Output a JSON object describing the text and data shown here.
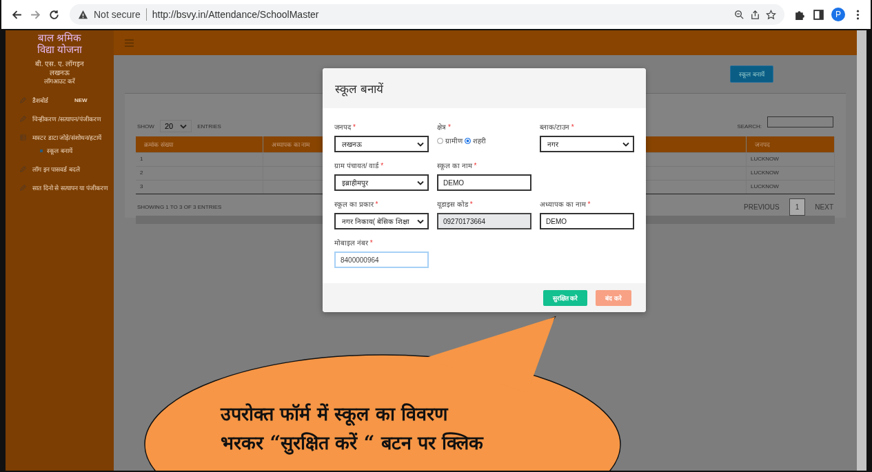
{
  "browser": {
    "security": "Not secure",
    "url": "http://bsvy.in/Attendance/SchoolMaster",
    "avatar": "P"
  },
  "sidebar": {
    "title_lines": [
      "बाल श्रमिक",
      "विद्या योजना"
    ],
    "user_lines": [
      "बी. एस. ए. लॉगइन",
      "लखनऊ"
    ],
    "logout": "लॉगआउट करें",
    "items": [
      {
        "label": "डैशबोर्ड",
        "badge": "NEW"
      },
      {
        "label": "चिन्हीकरण /सत्यापन/पंजीकरण"
      },
      {
        "label": "मास्टर डाटा जोड़े/संशोधन/हटायें",
        "children": [
          {
            "label": "स्कूल बनायें"
          }
        ]
      },
      {
        "label": "लॉग इन पासवर्ड बदले"
      },
      {
        "label": "सात दिनो से सत्यापन या पंजीकरण"
      }
    ]
  },
  "page": {
    "create_button": "स्कूल बनायें",
    "show_label": "SHOW",
    "page_size": "20",
    "entries_label": "ENTRIES",
    "search_label": "SEARCH:",
    "table": {
      "columns": [
        "क्रमांक संख्या",
        "अध्यापक का नाम",
        "जनपद"
      ],
      "rows": [
        [
          "1",
          "",
          "LUCKNOW"
        ],
        [
          "2",
          "",
          "LUCKNOW"
        ],
        [
          "3",
          "",
          "LUCKNOW"
        ]
      ]
    },
    "info": "SHOWING 1 TO 3 OF 3 ENTRIES",
    "pagination": {
      "previous": "PREVIOUS",
      "pages": [
        {
          "label": "1",
          "selected": true
        }
      ],
      "next": "NEXT"
    }
  },
  "modal": {
    "title": "स्कूल बनायें",
    "rows": [
      [
        {
          "kind": "select",
          "label": "जनपद",
          "mark": "*",
          "value": "लखनऊ"
        },
        {
          "kind": "radio",
          "label": "क्षेत्र",
          "mark": "*",
          "options": [
            {
              "label": "ग्रामीण",
              "selected": false
            },
            {
              "label": "शहरी",
              "selected": true
            }
          ]
        },
        {
          "kind": "select",
          "label": "ब्लाक/टाउन",
          "mark": "*",
          "value": "नगर"
        }
      ],
      [
        {
          "kind": "select",
          "label": "ग्राम पंचायत/ वार्ड",
          "mark": "*",
          "value": "इब्राहीमपुर"
        },
        {
          "kind": "text",
          "label": "स्कूल का नाम",
          "mark": "*",
          "value": "DEMO",
          "focused": false
        }
      ],
      [
        {
          "kind": "select",
          "label": "स्कूल का प्रकार",
          "mark": "*",
          "value": "नगर निकाय( बेसिक शिक्षा"
        },
        {
          "kind": "readonly",
          "label": "यूडाइस कोड",
          "mark": "*",
          "value": "09270173664"
        },
        {
          "kind": "text",
          "label": "अध्यापक का नाम",
          "mark": "*",
          "value": "DEMO",
          "focused": false
        }
      ],
      [
        {
          "kind": "text",
          "label": "मोबाइल नंबर",
          "mark": "*",
          "value": "8400000964",
          "focused": true
        }
      ]
    ],
    "buttons": [
      {
        "label": "सुरक्षित करे",
        "kind": "primary"
      },
      {
        "label": "बंद करे",
        "kind": "secondary"
      }
    ]
  },
  "callout": {
    "lines": [
      "उपरोक्त फॉर्म में स्कूल का विवरण",
      "भरकर “सुरक्षित करें “ बटन पर क्लिक"
    ]
  }
}
